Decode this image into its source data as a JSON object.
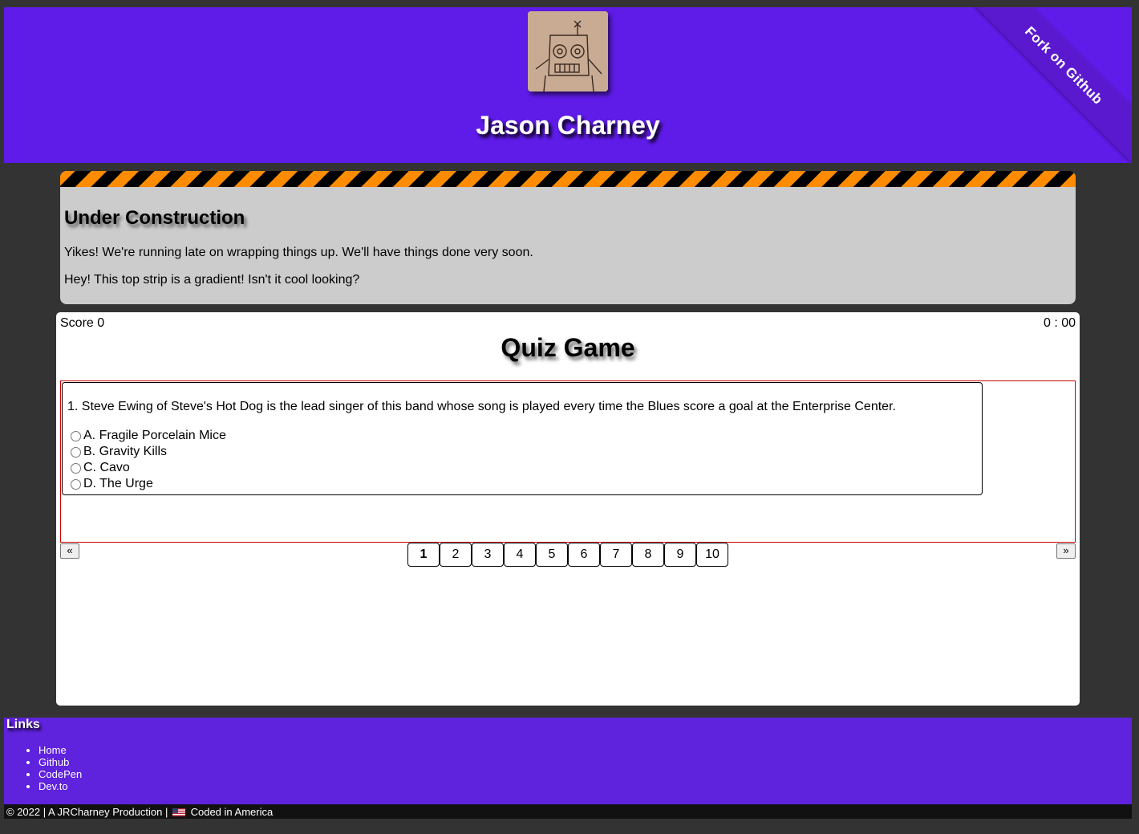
{
  "header": {
    "title": "Jason Charney",
    "ribbon_label": "Fork on Github"
  },
  "construction": {
    "heading": "Under Construction",
    "line1": "Yikes! We're running late on wrapping things up. We'll have things done very soon.",
    "line2": "Hey! This top strip is a gradient! Isn't it cool looking?"
  },
  "quiz": {
    "score_label": "Score 0",
    "timer": "0 : 00",
    "title": "Quiz Game",
    "question": "1. Steve Ewing of Steve's Hot Dog is the lead singer of this band whose song is played every time the Blues score a goal at the Enterprise Center.",
    "answers": [
      "A. Fragile Porcelain Mice",
      "B. Gravity Kills",
      "C. Cavo",
      "D. The Urge"
    ],
    "prev_label": "«",
    "next_label": "»",
    "pages": [
      "1",
      "2",
      "3",
      "4",
      "5",
      "6",
      "7",
      "8",
      "9",
      "10"
    ],
    "current_page": "1"
  },
  "footer": {
    "links_title": "Links",
    "links": [
      "Home",
      "Github",
      "CodePen",
      "Dev.to"
    ],
    "copyright_prefix": "© 2022 | A JRCharney Production |",
    "coded_in": "Coded in America"
  },
  "colors": {
    "header_bg": "#5f1be8",
    "page_bg": "#333333",
    "hazard_orange": "#ff8c00",
    "construction_bg": "#cccccc"
  },
  "icons": {
    "avatar": "robot-sketch-avatar",
    "flag": "us-flag-icon"
  }
}
